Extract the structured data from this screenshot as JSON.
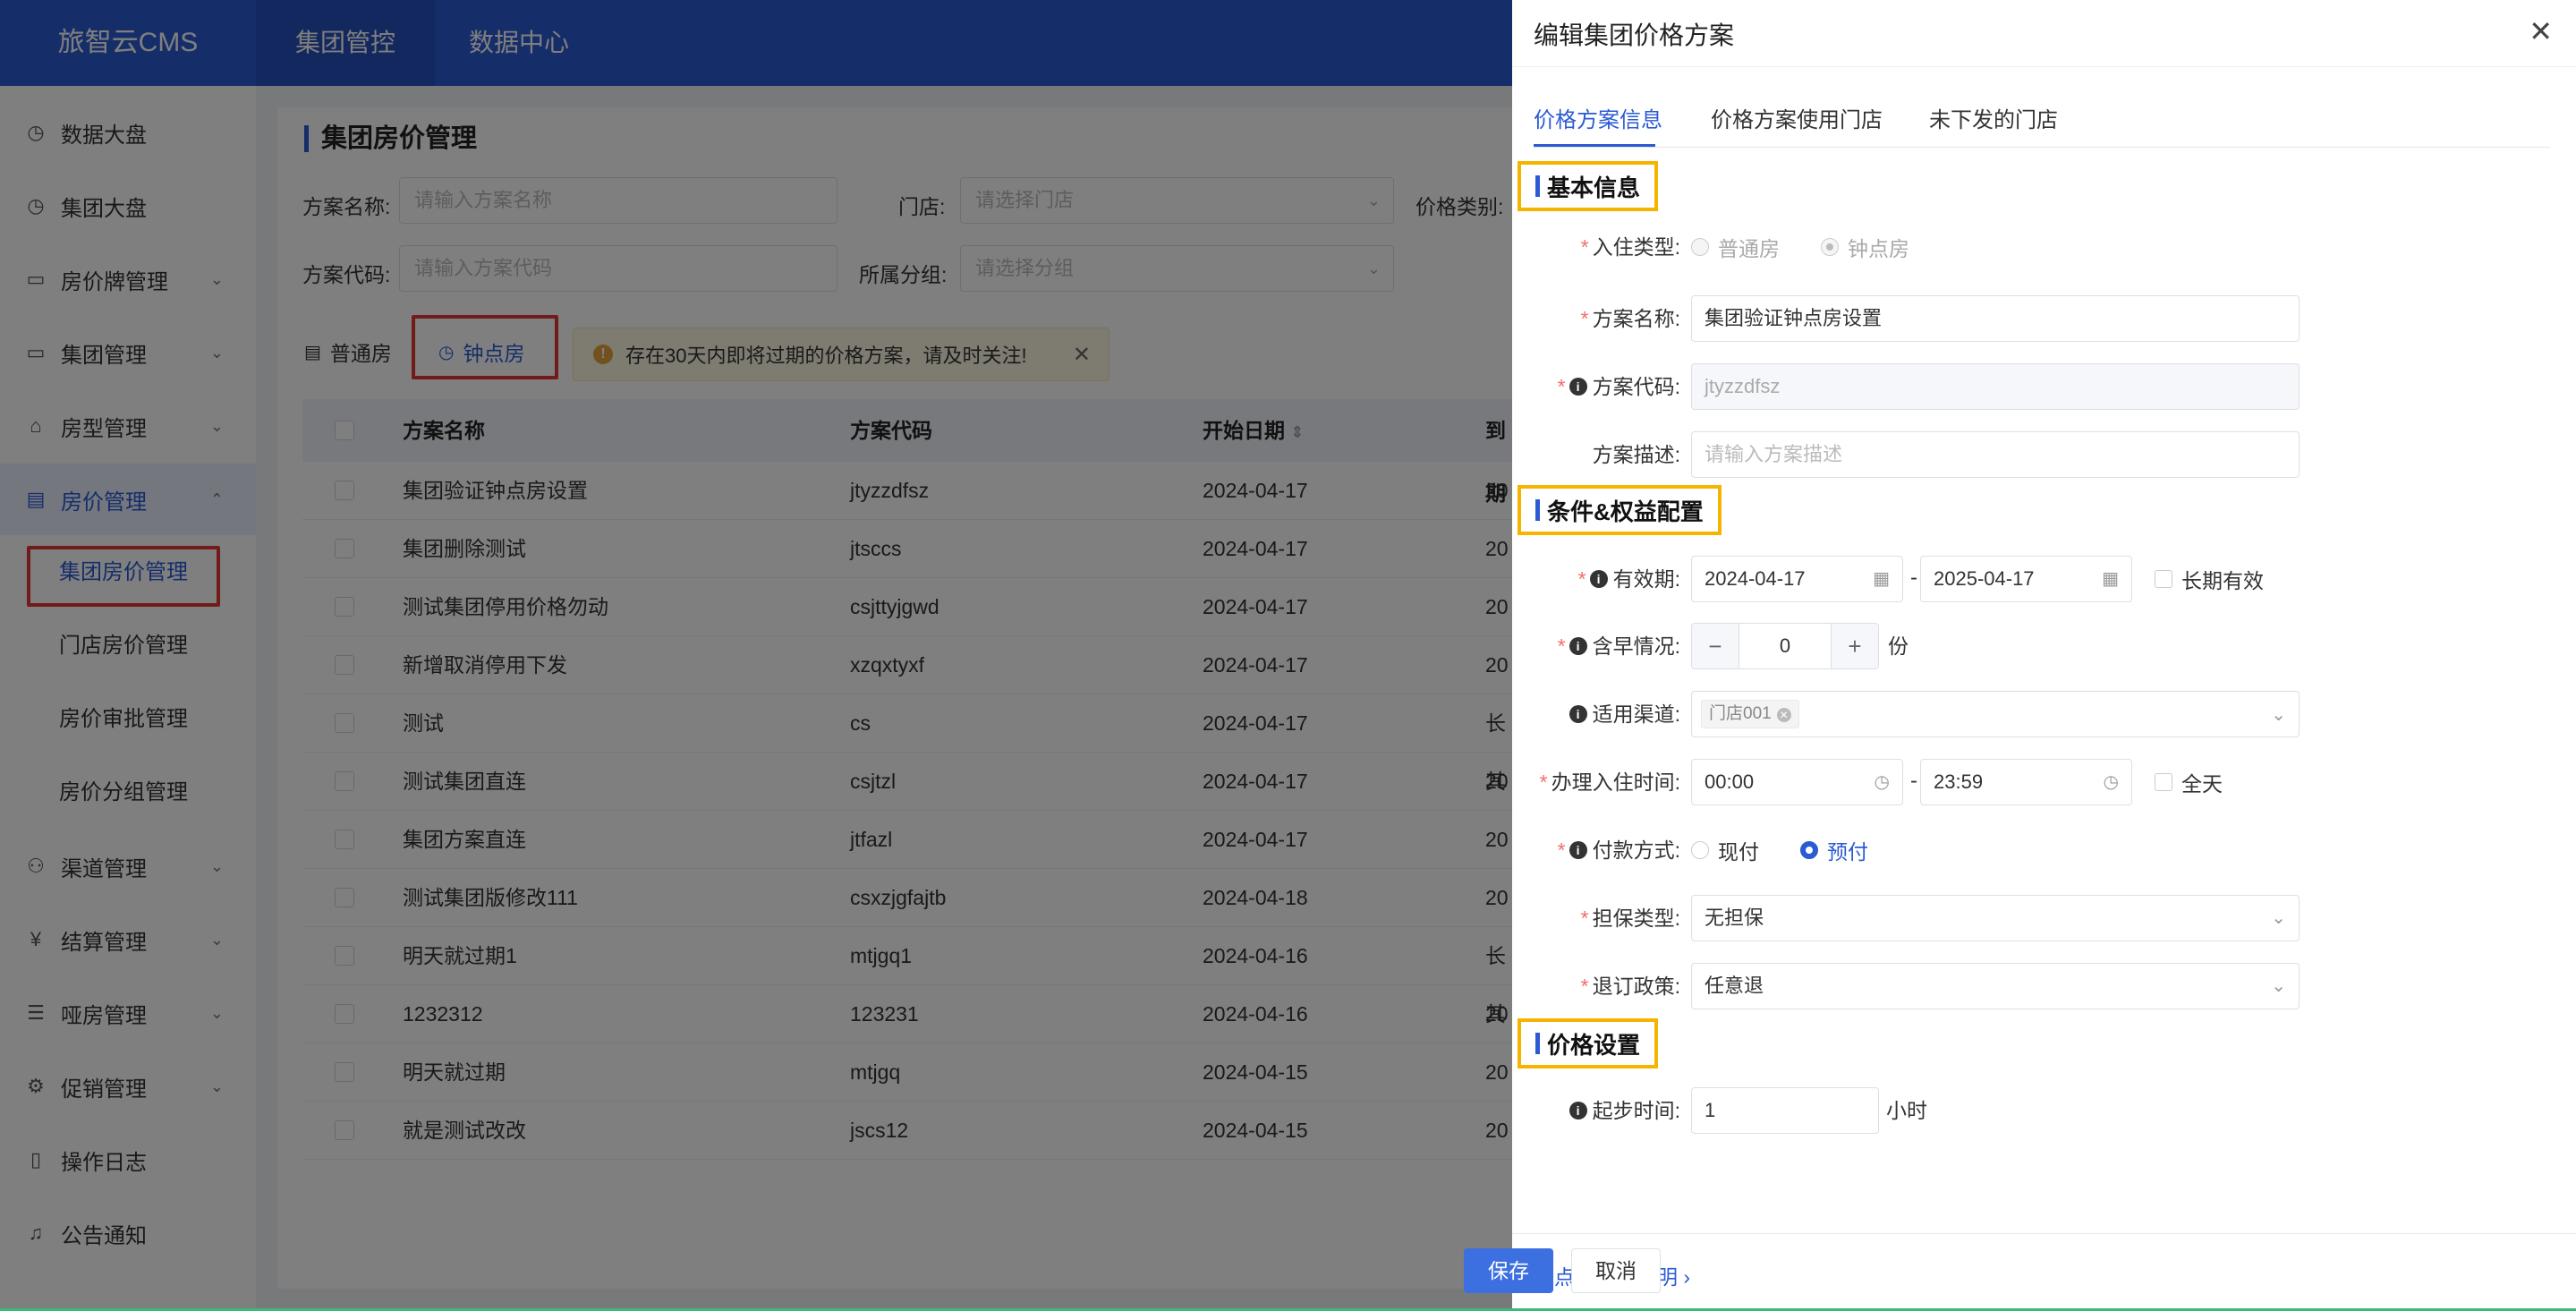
{
  "app": {
    "logo": "旅智云CMS"
  },
  "topnav": [
    {
      "label": "集团管控"
    },
    {
      "label": "数据中心"
    }
  ],
  "sidebar": {
    "items": [
      {
        "label": "数据大盘",
        "icon": "clock-icon"
      },
      {
        "label": "集团大盘",
        "icon": "clock-icon"
      },
      {
        "label": "房价牌管理",
        "icon": "board-icon"
      },
      {
        "label": "集团管理",
        "icon": "board-icon"
      },
      {
        "label": "房型管理",
        "icon": "home-icon"
      },
      {
        "label": "房价管理",
        "icon": "card-icon"
      },
      {
        "label": "渠道管理",
        "icon": "network-icon"
      },
      {
        "label": "结算管理",
        "icon": "yen-icon"
      },
      {
        "label": "哑房管理",
        "icon": "list-icon"
      },
      {
        "label": "促销管理",
        "icon": "gear-icon"
      },
      {
        "label": "操作日志",
        "icon": "doc-icon"
      },
      {
        "label": "公告通知",
        "icon": "bell-icon"
      }
    ],
    "subitems": [
      {
        "label": "集团房价管理"
      },
      {
        "label": "门店房价管理"
      },
      {
        "label": "房价审批管理"
      },
      {
        "label": "房价分组管理"
      }
    ]
  },
  "page": {
    "title": "集团房价管理",
    "filters": {
      "plan_name_label": "方案名称:",
      "plan_name_placeholder": "请输入方案名称",
      "store_label": "门店:",
      "store_placeholder": "请选择门店",
      "price_type_label": "价格类别:",
      "plan_code_label": "方案代码:",
      "plan_code_placeholder": "请输入方案代码",
      "group_label": "所属分组:",
      "group_placeholder": "请选择分组"
    },
    "toggle_normal": "普通房",
    "toggle_hourly": "钟点房",
    "alert_text": "存在30天内即将过期的价格方案，请及时关注!",
    "table": {
      "headers": [
        "方案名称",
        "方案代码",
        "开始日期",
        "到期"
      ],
      "rows": [
        {
          "name": "集团验证钟点房设置",
          "code": "jtyzzdfsz",
          "start": "2024-04-17",
          "end": "20"
        },
        {
          "name": "集团删除测试",
          "code": "jtsccs",
          "start": "2024-04-17",
          "end": "20"
        },
        {
          "name": "测试集团停用价格勿动",
          "code": "csjttyjgwd",
          "start": "2024-04-17",
          "end": "20"
        },
        {
          "name": "新增取消停用下发",
          "code": "xzqxtyxf",
          "start": "2024-04-17",
          "end": "20"
        },
        {
          "name": "测试",
          "code": "cs",
          "start": "2024-04-17",
          "end": "长其"
        },
        {
          "name": "测试集团直连",
          "code": "csjtzl",
          "start": "2024-04-17",
          "end": "20"
        },
        {
          "name": "集团方案直连",
          "code": "jtfazl",
          "start": "2024-04-17",
          "end": "20"
        },
        {
          "name": "测试集团版修改111",
          "code": "csxzjgfajtb",
          "start": "2024-04-18",
          "end": "20"
        },
        {
          "name": "明天就过期1",
          "code": "mtjgq1",
          "start": "2024-04-16",
          "end": "长其"
        },
        {
          "name": "1232312",
          "code": "123231",
          "start": "2024-04-16",
          "end": "20"
        },
        {
          "name": "明天就过期",
          "code": "mtjgq",
          "start": "2024-04-15",
          "end": "20"
        },
        {
          "name": "就是测试改改",
          "code": "jscs12",
          "start": "2024-04-15",
          "end": "20"
        }
      ]
    }
  },
  "drawer": {
    "title": "编辑集团价格方案",
    "tabs": [
      {
        "label": "价格方案信息"
      },
      {
        "label": "价格方案使用门店"
      },
      {
        "label": "未下发的门店"
      }
    ],
    "sections": {
      "basic": "基本信息",
      "conditions": "条件&权益配置",
      "price": "价格设置"
    },
    "fields": {
      "stay_type_label": "入住类型:",
      "stay_type_opt1": "普通房",
      "stay_type_opt2": "钟点房",
      "plan_name_label": "方案名称:",
      "plan_name_value": "集团验证钟点房设置",
      "plan_code_label": "方案代码:",
      "plan_code_value": "jtyzzdfsz",
      "plan_desc_label": "方案描述:",
      "plan_desc_placeholder": "请输入方案描述",
      "validity_label": "有效期:",
      "validity_start": "2024-04-17",
      "validity_sep": "-",
      "validity_end": "2025-04-17",
      "long_term_label": "长期有效",
      "breakfast_label": "含早情况:",
      "breakfast_value": "0",
      "breakfast_unit": "份",
      "channel_label": "适用渠道:",
      "channel_tag": "门店001",
      "checkin_label": "办理入住时间:",
      "checkin_start": "00:00",
      "checkin_end": "23:59",
      "all_day_label": "全天",
      "payment_label": "付款方式:",
      "payment_opt1": "现付",
      "payment_opt2": "预付",
      "guarantee_label": "担保类型:",
      "guarantee_value": "无担保",
      "refund_label": "退订政策:",
      "refund_value": "任意退",
      "start_time_label": "起步时间:",
      "start_time_value": "1",
      "start_time_unit": "小时"
    },
    "footer": {
      "help_link": "钟点房设置说明",
      "save_label": "保存",
      "cancel_label": "取消"
    }
  },
  "colors": {
    "brand": "#2b5bd3",
    "highlight_red": "#e53935",
    "highlight_yellow": "#f5b400"
  }
}
